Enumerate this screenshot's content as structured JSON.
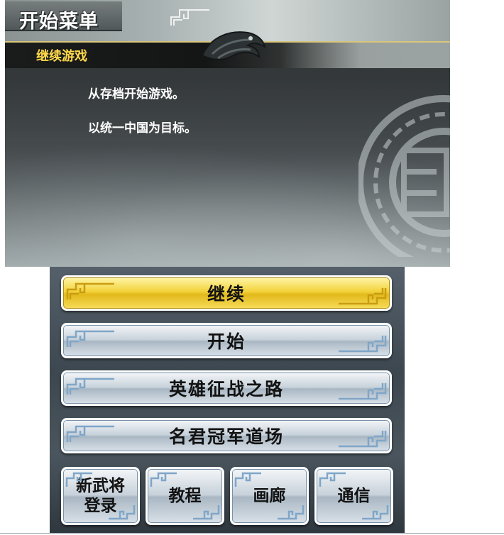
{
  "top_screen": {
    "menu_title": "开始菜单",
    "subheader_label": "继续游戏",
    "description_lines": [
      "从存档开始游戏。",
      "以统一中国为目标。"
    ]
  },
  "bottom_screen": {
    "menu_buttons": [
      {
        "label": "继续",
        "selected": true
      },
      {
        "label": "开始",
        "selected": false
      },
      {
        "label": "英雄征战之路",
        "selected": false
      },
      {
        "label": "名君冠军道场",
        "selected": false
      }
    ],
    "small_buttons": [
      {
        "label": "新武将登录"
      },
      {
        "label": "教程"
      },
      {
        "label": "画廊"
      },
      {
        "label": "通信"
      }
    ]
  },
  "colors": {
    "selected_button": "#f3d23a",
    "normal_button": "#c7d1da",
    "subheader_text": "#ffd94a",
    "fret_pattern": "#7fa6c8"
  },
  "icons": [
    "eagle-emblem-icon",
    "fret-pattern-icon",
    "medallion-icon"
  ]
}
